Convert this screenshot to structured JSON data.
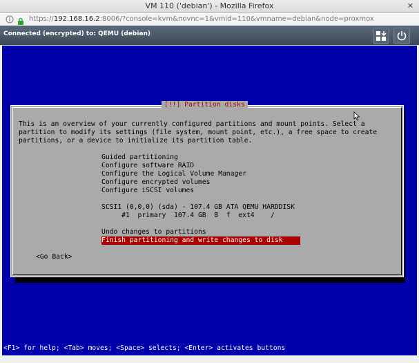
{
  "window": {
    "title": "VM 110 ('debian') - Mozilla Firefox",
    "close_glyph": "✕"
  },
  "browser": {
    "url_prefix": "https://",
    "url_host": "192.168.16.2",
    "url_rest": ":8006/?console=kvm&novnc=1&vmid=110&vmname=debian&node=proxmox"
  },
  "novnc": {
    "status": "Connected (encrypted) to: QEMU (debian)"
  },
  "installer": {
    "dialog_title": "[!!] Partition disks",
    "description": [
      "This is an overview of your currently configured partitions and mount points. Select a",
      "partition to modify its settings (file system, mount point, etc.), a free space to create",
      "partitions, or a device to initialize its partition table."
    ],
    "menu_items": [
      "Guided partitioning",
      "Configure software RAID",
      "Configure the Logical Volume Manager",
      "Configure encrypted volumes",
      "Configure iSCSI volumes"
    ],
    "disk_line": "SCSI1 (0,0,0) (sda) - 107.4 GB ATA QEMU HARDDISK",
    "partition_line": "     #1  primary  107.4 GB  B  f  ext4    /",
    "undo": "Undo changes to partitions",
    "finish": "Finish partitioning and write changes to disk",
    "go_back": "<Go Back>",
    "help_line": "<F1> for help; <Tab> moves; <Space> selects; <Enter> activates buttons"
  },
  "icons": {
    "info": "info-icon",
    "lock": "lock-icon",
    "extra_keys": "extra-keys-icon",
    "power": "power-icon"
  },
  "colors": {
    "screen_bg": "#0000aa",
    "dialog_bg": "#aaaaaa",
    "highlight": "#aa0000"
  }
}
